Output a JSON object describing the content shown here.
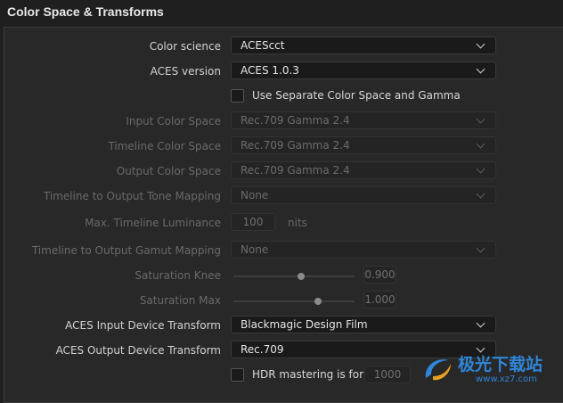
{
  "header": {
    "title": "Color Space & Transforms"
  },
  "color_science": {
    "label": "Color science",
    "value": "ACEScct"
  },
  "aces_version": {
    "label": "ACES version",
    "value": "ACES 1.0.3"
  },
  "separate_cs_gamma": {
    "label": "Use Separate Color Space and Gamma",
    "checked": false
  },
  "input_color_space": {
    "label": "Input Color Space",
    "value": "Rec.709 Gamma 2.4",
    "enabled": false
  },
  "timeline_color_space": {
    "label": "Timeline Color Space",
    "value": "Rec.709 Gamma 2.4",
    "enabled": false
  },
  "output_color_space": {
    "label": "Output Color Space",
    "value": "Rec.709 Gamma 2.4",
    "enabled": false
  },
  "tone_mapping": {
    "label": "Timeline to Output Tone Mapping",
    "value": "None",
    "enabled": false
  },
  "max_luminance": {
    "label": "Max. Timeline Luminance",
    "value": "100",
    "unit": "nits",
    "enabled": false
  },
  "gamut_mapping": {
    "label": "Timeline to Output Gamut Mapping",
    "value": "None",
    "enabled": false
  },
  "saturation_knee": {
    "label": "Saturation Knee",
    "value": "0.900",
    "slider_fraction": 0.56,
    "enabled": false
  },
  "saturation_max": {
    "label": "Saturation Max",
    "value": "1.000",
    "slider_fraction": 0.7,
    "enabled": false
  },
  "aces_idt": {
    "label": "ACES Input Device Transform",
    "value": "Blackmagic Design Film"
  },
  "aces_odt": {
    "label": "ACES Output Device Transform",
    "value": "Rec.709"
  },
  "hdr_mastering": {
    "label": "HDR mastering is for",
    "value": "1000",
    "checked": false
  },
  "watermark": {
    "text": "极光下载站",
    "url": "www.xz7.com"
  },
  "colors": {
    "background": "#282828",
    "accent": "#2f86d8"
  }
}
